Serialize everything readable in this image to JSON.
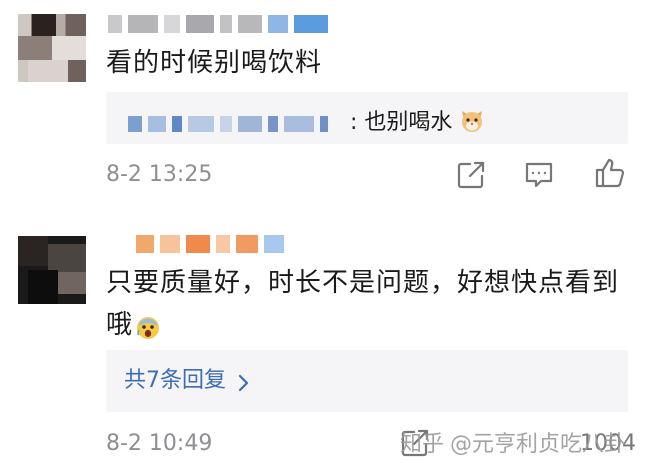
{
  "comments": [
    {
      "text": "看的时候别喝饮料",
      "reply_preview": {
        "text": ": 也别喝水",
        "emoji_icon": "cat-face-icon"
      },
      "time": "8-2 13:25"
    },
    {
      "text_line1": "只要质量好，时长不是问题，好想快点看到",
      "text_line2": "哦",
      "emoji_icon": "scared-face-icon",
      "expand_label": "共7条回复",
      "time": "8-2 10:49"
    }
  ],
  "watermark": {
    "site": "知乎",
    "handle": "@元亨利贞吃八卦"
  },
  "like_count": "1004",
  "colors": {
    "link": "#3d6db4",
    "meta": "#8e8e93",
    "panel": "#f5f5f7"
  }
}
